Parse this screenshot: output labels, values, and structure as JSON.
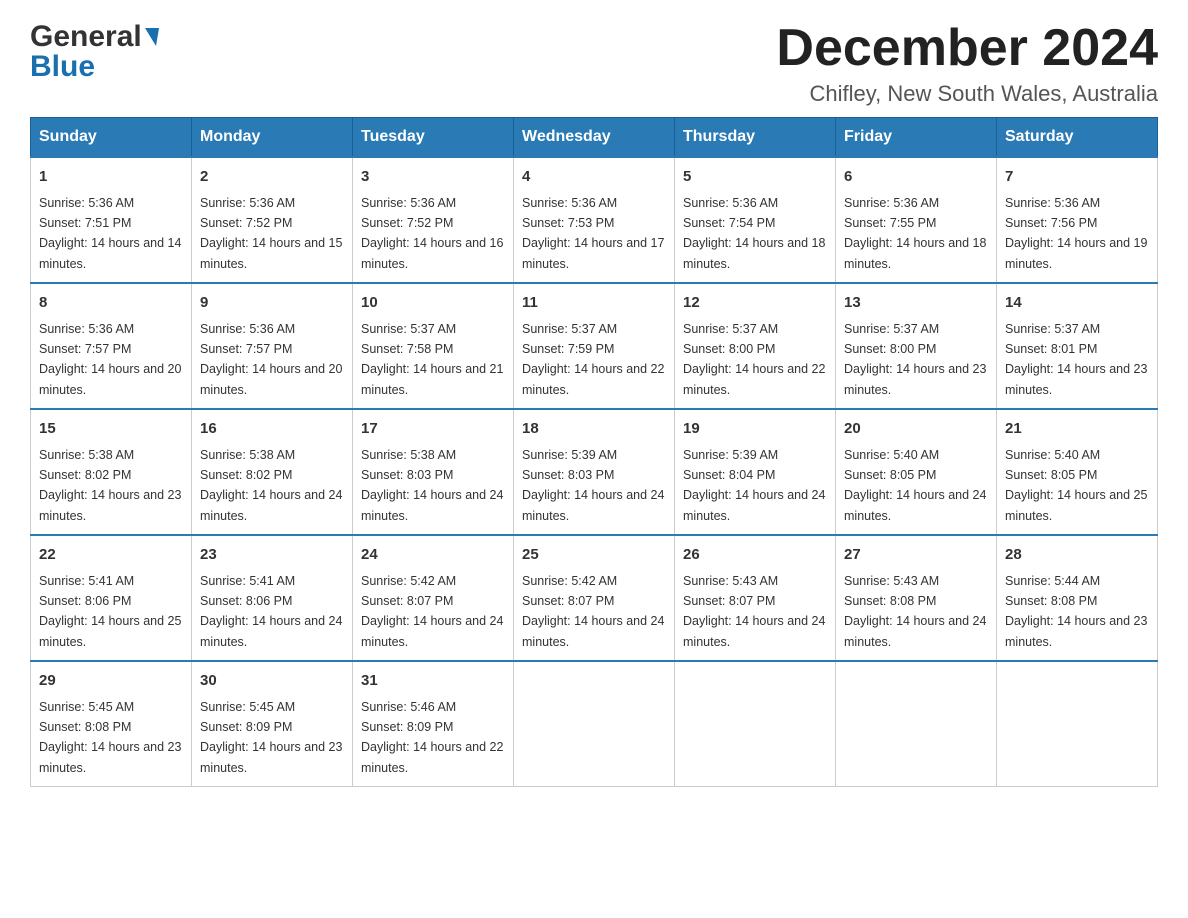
{
  "header": {
    "logo": {
      "line1": "General",
      "line2": "Blue"
    },
    "title": "December 2024",
    "location": "Chifley, New South Wales, Australia"
  },
  "weekdays": [
    "Sunday",
    "Monday",
    "Tuesday",
    "Wednesday",
    "Thursday",
    "Friday",
    "Saturday"
  ],
  "weeks": [
    [
      {
        "day": "1",
        "sunrise": "5:36 AM",
        "sunset": "7:51 PM",
        "daylight": "14 hours and 14 minutes."
      },
      {
        "day": "2",
        "sunrise": "5:36 AM",
        "sunset": "7:52 PM",
        "daylight": "14 hours and 15 minutes."
      },
      {
        "day": "3",
        "sunrise": "5:36 AM",
        "sunset": "7:52 PM",
        "daylight": "14 hours and 16 minutes."
      },
      {
        "day": "4",
        "sunrise": "5:36 AM",
        "sunset": "7:53 PM",
        "daylight": "14 hours and 17 minutes."
      },
      {
        "day": "5",
        "sunrise": "5:36 AM",
        "sunset": "7:54 PM",
        "daylight": "14 hours and 18 minutes."
      },
      {
        "day": "6",
        "sunrise": "5:36 AM",
        "sunset": "7:55 PM",
        "daylight": "14 hours and 18 minutes."
      },
      {
        "day": "7",
        "sunrise": "5:36 AM",
        "sunset": "7:56 PM",
        "daylight": "14 hours and 19 minutes."
      }
    ],
    [
      {
        "day": "8",
        "sunrise": "5:36 AM",
        "sunset": "7:57 PM",
        "daylight": "14 hours and 20 minutes."
      },
      {
        "day": "9",
        "sunrise": "5:36 AM",
        "sunset": "7:57 PM",
        "daylight": "14 hours and 20 minutes."
      },
      {
        "day": "10",
        "sunrise": "5:37 AM",
        "sunset": "7:58 PM",
        "daylight": "14 hours and 21 minutes."
      },
      {
        "day": "11",
        "sunrise": "5:37 AM",
        "sunset": "7:59 PM",
        "daylight": "14 hours and 22 minutes."
      },
      {
        "day": "12",
        "sunrise": "5:37 AM",
        "sunset": "8:00 PM",
        "daylight": "14 hours and 22 minutes."
      },
      {
        "day": "13",
        "sunrise": "5:37 AM",
        "sunset": "8:00 PM",
        "daylight": "14 hours and 23 minutes."
      },
      {
        "day": "14",
        "sunrise": "5:37 AM",
        "sunset": "8:01 PM",
        "daylight": "14 hours and 23 minutes."
      }
    ],
    [
      {
        "day": "15",
        "sunrise": "5:38 AM",
        "sunset": "8:02 PM",
        "daylight": "14 hours and 23 minutes."
      },
      {
        "day": "16",
        "sunrise": "5:38 AM",
        "sunset": "8:02 PM",
        "daylight": "14 hours and 24 minutes."
      },
      {
        "day": "17",
        "sunrise": "5:38 AM",
        "sunset": "8:03 PM",
        "daylight": "14 hours and 24 minutes."
      },
      {
        "day": "18",
        "sunrise": "5:39 AM",
        "sunset": "8:03 PM",
        "daylight": "14 hours and 24 minutes."
      },
      {
        "day": "19",
        "sunrise": "5:39 AM",
        "sunset": "8:04 PM",
        "daylight": "14 hours and 24 minutes."
      },
      {
        "day": "20",
        "sunrise": "5:40 AM",
        "sunset": "8:05 PM",
        "daylight": "14 hours and 24 minutes."
      },
      {
        "day": "21",
        "sunrise": "5:40 AM",
        "sunset": "8:05 PM",
        "daylight": "14 hours and 25 minutes."
      }
    ],
    [
      {
        "day": "22",
        "sunrise": "5:41 AM",
        "sunset": "8:06 PM",
        "daylight": "14 hours and 25 minutes."
      },
      {
        "day": "23",
        "sunrise": "5:41 AM",
        "sunset": "8:06 PM",
        "daylight": "14 hours and 24 minutes."
      },
      {
        "day": "24",
        "sunrise": "5:42 AM",
        "sunset": "8:07 PM",
        "daylight": "14 hours and 24 minutes."
      },
      {
        "day": "25",
        "sunrise": "5:42 AM",
        "sunset": "8:07 PM",
        "daylight": "14 hours and 24 minutes."
      },
      {
        "day": "26",
        "sunrise": "5:43 AM",
        "sunset": "8:07 PM",
        "daylight": "14 hours and 24 minutes."
      },
      {
        "day": "27",
        "sunrise": "5:43 AM",
        "sunset": "8:08 PM",
        "daylight": "14 hours and 24 minutes."
      },
      {
        "day": "28",
        "sunrise": "5:44 AM",
        "sunset": "8:08 PM",
        "daylight": "14 hours and 23 minutes."
      }
    ],
    [
      {
        "day": "29",
        "sunrise": "5:45 AM",
        "sunset": "8:08 PM",
        "daylight": "14 hours and 23 minutes."
      },
      {
        "day": "30",
        "sunrise": "5:45 AM",
        "sunset": "8:09 PM",
        "daylight": "14 hours and 23 minutes."
      },
      {
        "day": "31",
        "sunrise": "5:46 AM",
        "sunset": "8:09 PM",
        "daylight": "14 hours and 22 minutes."
      },
      null,
      null,
      null,
      null
    ]
  ]
}
